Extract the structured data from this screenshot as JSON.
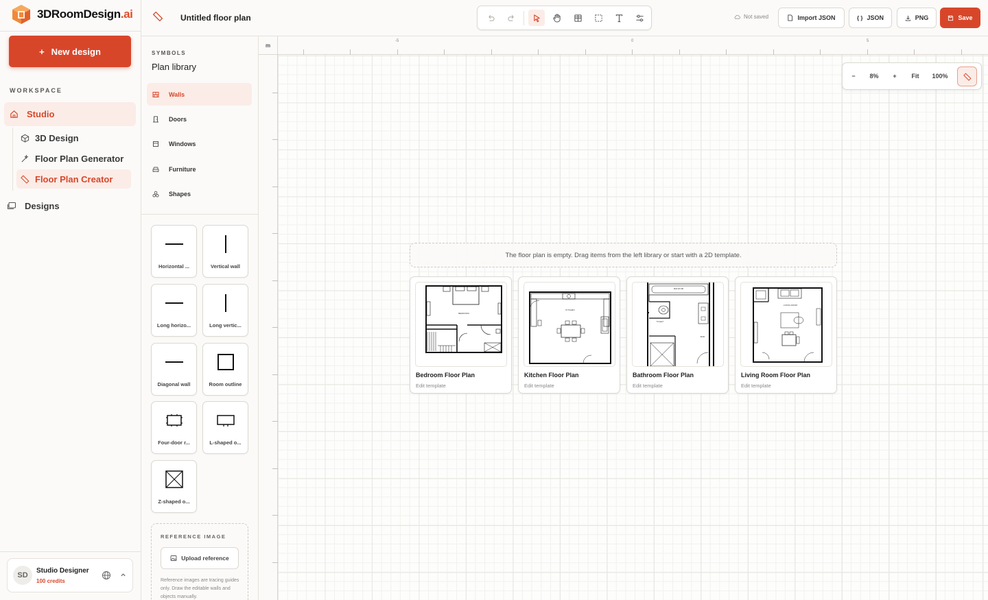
{
  "app": {
    "logo_text": "3DRoomDesign",
    "logo_suffix": ".ai",
    "new_design_label": "New design",
    "workspace_label": "WORKSPACE",
    "nav": {
      "studio": "Studio",
      "sub_items": [
        "3D Design",
        "Floor Plan Generator",
        "Floor Plan Creator"
      ],
      "designs": "Designs"
    },
    "user": {
      "initials": "SD",
      "name": "Studio Designer",
      "credits": "100 credits"
    }
  },
  "header": {
    "title": "Untitled floor plan",
    "status": "Not saved",
    "import_label": "Import JSON",
    "json_label": "JSON",
    "png_label": "PNG",
    "save_label": "Save",
    "tools": [
      "undo-icon",
      "redo-icon",
      "select-icon",
      "pan-icon",
      "table-icon",
      "marquee-icon",
      "text-icon",
      "settings-icon"
    ]
  },
  "panel": {
    "symbols_label": "SYMBOLS",
    "library_title": "Plan library",
    "categories": [
      "Walls",
      "Doors",
      "Windows",
      "Furniture",
      "Shapes"
    ],
    "tiles": [
      "Horizontal ...",
      "Vertical wall",
      "Long horizo...",
      "Long vertic...",
      "Diagonal wall",
      "Room outline",
      "Four-door r...",
      "L-shaped o...",
      "Z-shaped o..."
    ],
    "reference": {
      "label": "REFERENCE IMAGE",
      "button": "Upload reference",
      "note": "Reference images are tracing guides only. Draw the editable walls and objects manually."
    }
  },
  "canvas": {
    "unit": "m",
    "ruler_top": [
      "-5",
      "0",
      "5"
    ],
    "zoom": {
      "minus": "−",
      "value": "8%",
      "plus": "+",
      "fit": "Fit",
      "reset": "100%"
    },
    "empty_message": "The floor plan is empty. Drag items from the left library or start with a 2D template.",
    "templates": [
      {
        "name": "Bedroom Floor Plan",
        "action": "Edit template"
      },
      {
        "name": "Kitchen Floor Plan",
        "action": "Edit template"
      },
      {
        "name": "Bathroom Floor Plan",
        "action": "Edit template"
      },
      {
        "name": "Living Room Floor Plan",
        "action": "Edit template"
      }
    ]
  },
  "colors": {
    "accent": "#d8462a",
    "accent_soft": "#fbece7",
    "border": "#dcd8d2"
  }
}
